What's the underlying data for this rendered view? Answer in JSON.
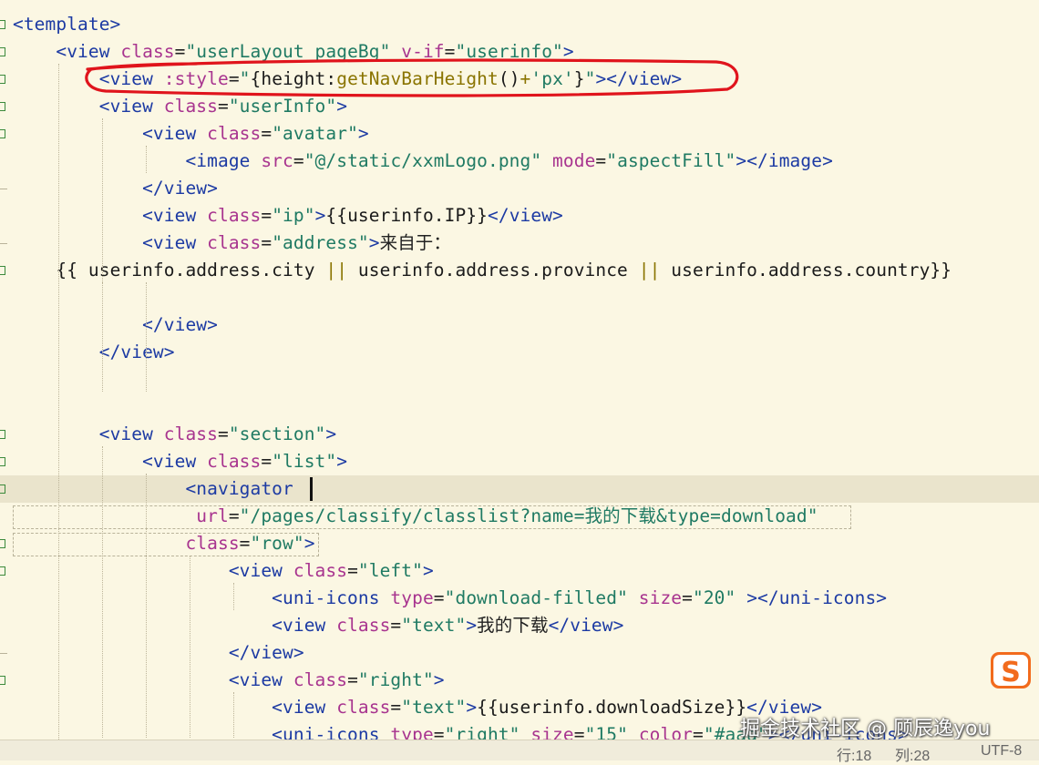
{
  "code_lines": [
    [
      [
        "tag",
        "<template>"
      ]
    ],
    [
      [
        "plain",
        "    "
      ],
      [
        "tag",
        "<view "
      ],
      [
        "attr",
        "class"
      ],
      [
        "plain",
        "="
      ],
      [
        "str",
        "\"userLayout pageBg\""
      ],
      [
        "plain",
        " "
      ],
      [
        "attr",
        "v-if"
      ],
      [
        "plain",
        "="
      ],
      [
        "str",
        "\"userinfo\""
      ],
      [
        "tag",
        ">"
      ]
    ],
    [
      [
        "plain",
        "        "
      ],
      [
        "tag",
        "<view "
      ],
      [
        "attr",
        ":style"
      ],
      [
        "plain",
        "="
      ],
      [
        "str",
        "\""
      ],
      [
        "expr",
        "{height:"
      ],
      [
        "fn",
        "getNavBarHeight"
      ],
      [
        "expr",
        "()"
      ],
      [
        "op",
        "+"
      ],
      [
        "str",
        "'px'"
      ],
      [
        "expr",
        "}"
      ],
      [
        "str",
        "\""
      ],
      [
        "tag",
        "></view>"
      ]
    ],
    [
      [
        "plain",
        "        "
      ],
      [
        "tag",
        "<view "
      ],
      [
        "attr",
        "class"
      ],
      [
        "plain",
        "="
      ],
      [
        "str",
        "\"userInfo\""
      ],
      [
        "tag",
        ">"
      ]
    ],
    [
      [
        "plain",
        "            "
      ],
      [
        "tag",
        "<view "
      ],
      [
        "attr",
        "class"
      ],
      [
        "plain",
        "="
      ],
      [
        "str",
        "\"avatar\""
      ],
      [
        "tag",
        ">"
      ]
    ],
    [
      [
        "plain",
        "                "
      ],
      [
        "tag",
        "<image "
      ],
      [
        "attr",
        "src"
      ],
      [
        "plain",
        "="
      ],
      [
        "str",
        "\"@/static/xxmLogo.png\""
      ],
      [
        "plain",
        " "
      ],
      [
        "attr",
        "mode"
      ],
      [
        "plain",
        "="
      ],
      [
        "str",
        "\"aspectFill\""
      ],
      [
        "tag",
        "></image>"
      ]
    ],
    [
      [
        "plain",
        "            "
      ],
      [
        "tag",
        "</view>"
      ]
    ],
    [
      [
        "plain",
        "            "
      ],
      [
        "tag",
        "<view "
      ],
      [
        "attr",
        "class"
      ],
      [
        "plain",
        "="
      ],
      [
        "str",
        "\"ip\""
      ],
      [
        "tag",
        ">"
      ],
      [
        "expr",
        "{{userinfo.IP}}"
      ],
      [
        "tag",
        "</view>"
      ]
    ],
    [
      [
        "plain",
        "            "
      ],
      [
        "tag",
        "<view "
      ],
      [
        "attr",
        "class"
      ],
      [
        "plain",
        "="
      ],
      [
        "str",
        "\"address\""
      ],
      [
        "tag",
        ">"
      ],
      [
        "cjk",
        "来自于："
      ]
    ],
    [
      [
        "plain",
        "    "
      ],
      [
        "expr",
        "{{ userinfo.address.city "
      ],
      [
        "op",
        "||"
      ],
      [
        "expr",
        " userinfo.address.province "
      ],
      [
        "op",
        "||"
      ],
      [
        "expr",
        " userinfo.address.country}}"
      ]
    ],
    [],
    [
      [
        "plain",
        "            "
      ],
      [
        "tag",
        "</view>"
      ]
    ],
    [
      [
        "plain",
        "        "
      ],
      [
        "tag",
        "</view>"
      ]
    ],
    [],
    [],
    [
      [
        "plain",
        "        "
      ],
      [
        "tag",
        "<view "
      ],
      [
        "attr",
        "class"
      ],
      [
        "plain",
        "="
      ],
      [
        "str",
        "\"section\""
      ],
      [
        "tag",
        ">"
      ]
    ],
    [
      [
        "plain",
        "            "
      ],
      [
        "tag",
        "<view "
      ],
      [
        "attr",
        "class"
      ],
      [
        "plain",
        "="
      ],
      [
        "str",
        "\"list\""
      ],
      [
        "tag",
        ">"
      ]
    ],
    [
      [
        "plain",
        "                "
      ],
      [
        "tag",
        "<navigator"
      ]
    ],
    [
      [
        "plain",
        "                 "
      ],
      [
        "attr",
        "url"
      ],
      [
        "plain",
        "="
      ],
      [
        "str",
        "\"/pages/classify/classlist?name="
      ],
      [
        "strcjk",
        "我的下载"
      ],
      [
        "str",
        "&type=download\""
      ]
    ],
    [
      [
        "plain",
        "                "
      ],
      [
        "attr",
        "class"
      ],
      [
        "plain",
        "="
      ],
      [
        "str",
        "\"row\""
      ],
      [
        "tag",
        ">"
      ]
    ],
    [
      [
        "plain",
        "                    "
      ],
      [
        "tag",
        "<view "
      ],
      [
        "attr",
        "class"
      ],
      [
        "plain",
        "="
      ],
      [
        "str",
        "\"left\""
      ],
      [
        "tag",
        ">"
      ]
    ],
    [
      [
        "plain",
        "                        "
      ],
      [
        "tag",
        "<uni-icons "
      ],
      [
        "attr",
        "type"
      ],
      [
        "plain",
        "="
      ],
      [
        "str",
        "\"download-filled\""
      ],
      [
        "plain",
        " "
      ],
      [
        "attr",
        "size"
      ],
      [
        "plain",
        "="
      ],
      [
        "str",
        "\"20\""
      ],
      [
        "plain",
        " "
      ],
      [
        "tag",
        "></uni-icons>"
      ]
    ],
    [
      [
        "plain",
        "                        "
      ],
      [
        "tag",
        "<view "
      ],
      [
        "attr",
        "class"
      ],
      [
        "plain",
        "="
      ],
      [
        "str",
        "\"text\""
      ],
      [
        "tag",
        ">"
      ],
      [
        "cjk",
        "我的下载"
      ],
      [
        "tag",
        "</view>"
      ]
    ],
    [
      [
        "plain",
        "                    "
      ],
      [
        "tag",
        "</view>"
      ]
    ],
    [
      [
        "plain",
        "                    "
      ],
      [
        "tag",
        "<view "
      ],
      [
        "attr",
        "class"
      ],
      [
        "plain",
        "="
      ],
      [
        "str",
        "\"right\""
      ],
      [
        "tag",
        ">"
      ]
    ],
    [
      [
        "plain",
        "                        "
      ],
      [
        "tag",
        "<view "
      ],
      [
        "attr",
        "class"
      ],
      [
        "plain",
        "="
      ],
      [
        "str",
        "\"text\""
      ],
      [
        "tag",
        ">"
      ],
      [
        "expr",
        "{{userinfo.downloadSize}}"
      ],
      [
        "tag",
        "</view>"
      ]
    ],
    [
      [
        "plain",
        "                        "
      ],
      [
        "tag",
        "<uni-icons "
      ],
      [
        "attr",
        "type"
      ],
      [
        "plain",
        "="
      ],
      [
        "str",
        "\"right\""
      ],
      [
        "plain",
        " "
      ],
      [
        "attr",
        "size"
      ],
      [
        "plain",
        "="
      ],
      [
        "str",
        "\"15\""
      ],
      [
        "plain",
        " "
      ],
      [
        "attr",
        "color"
      ],
      [
        "plain",
        "="
      ],
      [
        "str",
        "\"#aaa\""
      ],
      [
        "tag",
        "></uni-icons>"
      ]
    ]
  ],
  "current_line_index": 17,
  "fold_marker_lines": [
    0,
    1,
    2,
    3,
    4,
    9,
    15,
    16,
    17,
    19,
    20,
    24
  ],
  "tick_marker_lines": [
    6,
    8,
    23
  ],
  "status": {
    "row": "行:18",
    "col": "列:28",
    "encoding": "UTF-8"
  },
  "watermark": "掘金技术社区 @ 顾辰逸you",
  "ime_icon": "sogou-ime-icon",
  "annotation_color": "#e0141c",
  "colors": {
    "tag": "#1c3aa3",
    "attr": "#a8348f",
    "string": "#1f7a63",
    "background": "#fbf7e3"
  }
}
